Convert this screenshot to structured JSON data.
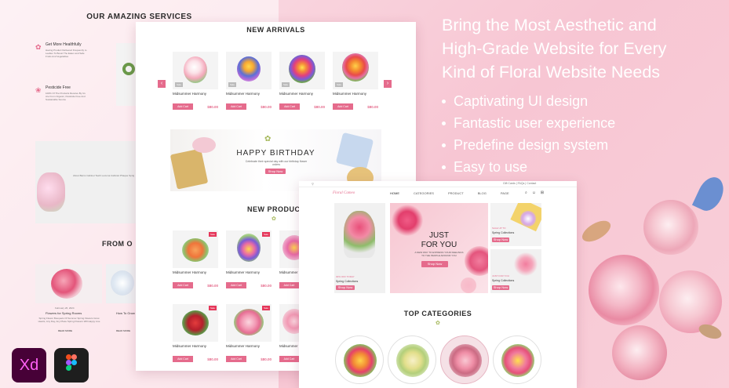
{
  "headline": {
    "line1": "Bring the Most Aesthetic and",
    "line2": "High-Grade Website for Every",
    "line3": "Kind of Floral Website Needs"
  },
  "features": [
    "Captivating UI design",
    "Fantastic user experience",
    "Predefine design system",
    "Easy to use"
  ],
  "services": {
    "title": "OUR AMAZING SERVICES",
    "item1_title": "Get More Healthfully",
    "item1_text": "Having Product Delivered Frequently to Leafies To Boost The Eaten and Safe Fruits And Vegetables",
    "item2_title": "Pesticide Free",
    "item2_text": "100% Of The Products Receive By Us Are From Organic, Pesticide Free And Sustainable Source",
    "about_text": "About Barns Cabinet Teeth Lecuma Cabiniet Phaque Sprig"
  },
  "blog": {
    "title": "FROM O",
    "post1_date": "February 26, 2024",
    "post1_title": "Flowers for Spring Rooms",
    "post1_text": "Spring Flower Bouquets Of Summer Spring Flowers Grow Hearts, Any Day, Any Place Spring Flowers Will Happy Live",
    "post2_title": "How To Grow Sp",
    "read_more": "READ MORE"
  },
  "arrivals": {
    "title": "NEW ARRIVALS",
    "products": [
      {
        "name": "Midsummer Harmony",
        "price": "$80.00",
        "add": "Add Cart"
      },
      {
        "name": "Midsummer Harmony",
        "price": "$80.00",
        "add": "Add Cart"
      },
      {
        "name": "Midsummer Harmony",
        "price": "$80.00",
        "add": "Add Cart"
      },
      {
        "name": "Midsummer Harmony",
        "price": "$80.00",
        "add": "Add Cart"
      }
    ]
  },
  "birthday": {
    "title": "HAPPY BIRTHDAY",
    "sub": "Celebrate their special day with our birthday flower orders",
    "btn": "Shop Now"
  },
  "new_products": {
    "title": "NEW PRODUC",
    "products": [
      {
        "name": "Midsummer Harmony",
        "price": "$80.00",
        "add": "Add Cart"
      },
      {
        "name": "Midsummer Harmony",
        "price": "$80.00",
        "add": "Add Cart"
      },
      {
        "name": "Midsummer Harmony",
        "price": "$80.00",
        "add": "Add Cart"
      },
      {
        "name": "Midsummer Harmony",
        "price": "$80.00",
        "add": "Add Cart"
      },
      {
        "name": "Midsummer Harmony",
        "price": "$80.00",
        "add": "Add Cart"
      },
      {
        "name": "Midsummer Harmony",
        "price": "$80.00",
        "add": "Add Cart"
      }
    ]
  },
  "shop": {
    "logo": "Floral Cameo",
    "nav": [
      "HOME",
      "CATEGORIES",
      "PRODUCT",
      "BLOG",
      "PAGE"
    ],
    "top_right": "Gift Cards | FAQs | Contact",
    "hero_title1": "JUST",
    "hero_title2": "FOR YOU",
    "hero_sub": "A NEW WAY TO EXPRESS YOUR FEELINGS TO THE PEOPLE AROUND YOU",
    "hero_btn": "Shop Now",
    "left_tag": "30% OFF TODAY",
    "left_title": "Spring Collections",
    "left_btn": "Shop Now",
    "right1_tag": "SALE UP TO",
    "right1_title": "Spring Collections",
    "right1_btn": "Shop Now",
    "right2_tag": "JUST FOR YOU",
    "right2_title": "Spring Collections",
    "right2_btn": "Shop Now",
    "categories_title": "TOP CATEGORIES"
  },
  "tools": {
    "xd": "Xd"
  },
  "colors": {
    "accent": "#e56b8c",
    "background": "#f8cfd9",
    "xd_bg": "#470137",
    "xd_fg": "#ff61f6"
  }
}
